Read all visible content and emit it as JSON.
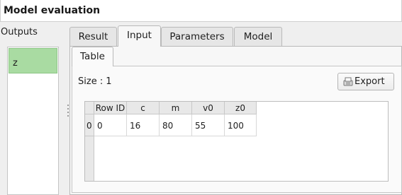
{
  "window": {
    "title": "Model evaluation"
  },
  "outputs": {
    "label": "Outputs",
    "items": [
      "z"
    ]
  },
  "tabs": [
    {
      "label": "Result"
    },
    {
      "label": "Input",
      "active": true
    },
    {
      "label": "Parameters"
    },
    {
      "label": "Model"
    }
  ],
  "input": {
    "subtab": "Table",
    "size_label": "Size :",
    "size_value": "1",
    "export_label": "Export",
    "table": {
      "columns": [
        "Row ID",
        "c",
        "m",
        "v0",
        "z0"
      ],
      "row_headers": [
        "0"
      ],
      "rows": [
        [
          "0",
          "16",
          "80",
          "55",
          "100"
        ]
      ]
    }
  },
  "colors": {
    "selected_item": "#a9dba2"
  },
  "icons": {
    "export": "export-icon"
  }
}
